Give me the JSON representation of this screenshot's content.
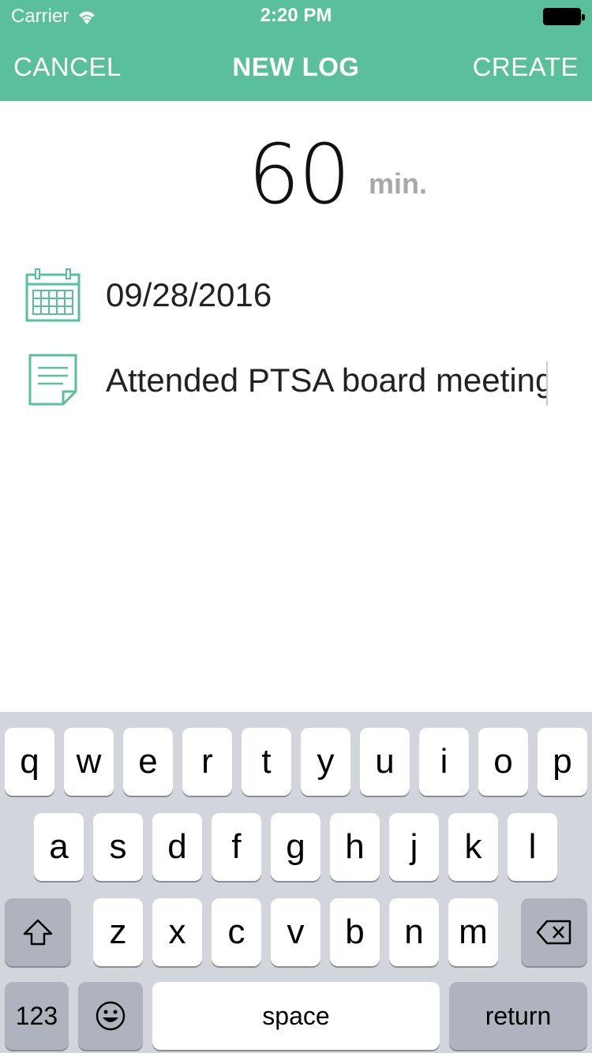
{
  "status_bar": {
    "carrier": "Carrier",
    "time": "2:20 PM",
    "icons": [
      "wifi-icon",
      "battery-icon"
    ]
  },
  "nav": {
    "cancel_label": "CANCEL",
    "title": "NEW LOG",
    "create_label": "CREATE"
  },
  "log": {
    "duration_value": "60",
    "duration_unit": "min.",
    "date": "09/28/2016",
    "note": "Attended PTSA board meeting",
    "icons": [
      "calendar-icon",
      "note-icon"
    ]
  },
  "keyboard": {
    "row1": [
      "q",
      "w",
      "e",
      "r",
      "t",
      "y",
      "u",
      "i",
      "o",
      "p"
    ],
    "row2": [
      "a",
      "s",
      "d",
      "f",
      "g",
      "h",
      "j",
      "k",
      "l"
    ],
    "row3": [
      "z",
      "x",
      "c",
      "v",
      "b",
      "n",
      "m"
    ],
    "numbers_label": "123",
    "space_label": "space",
    "return_label": "return",
    "icons": [
      "shift-icon",
      "backspace-icon",
      "emoji-icon"
    ]
  },
  "colors": {
    "accent": "#5abf9b",
    "keyboard_bg": "#d2d5db",
    "key_dark": "#aeb3bd",
    "unit_gray": "#a8a8a8"
  }
}
